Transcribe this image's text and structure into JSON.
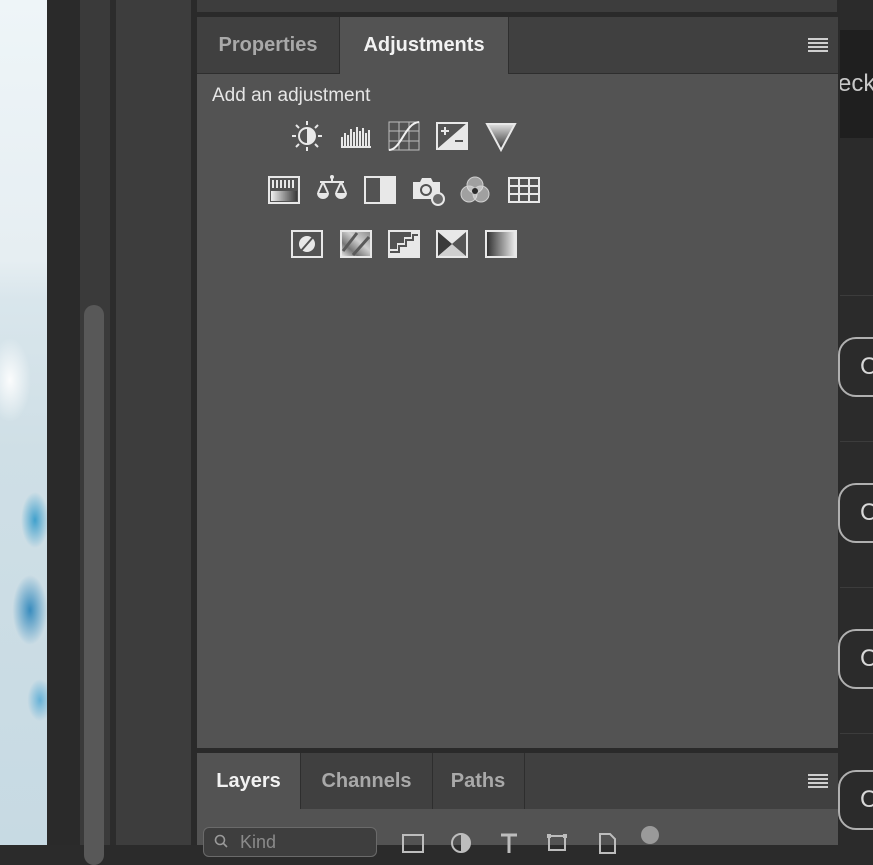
{
  "properties_panel": {
    "tabs": [
      {
        "label": "Properties",
        "active": false
      },
      {
        "label": "Adjustments",
        "active": true
      }
    ],
    "menu_icon": "panel-menu-icon",
    "heading": "Add an adjustment",
    "adjustment_icons": [
      [
        "brightness-contrast-icon",
        "levels-icon",
        "curves-icon",
        "exposure-icon",
        "vibrance-icon"
      ],
      [
        "hue-saturation-icon",
        "color-balance-icon",
        "black-white-icon",
        "photo-filter-icon",
        "channel-mixer-icon",
        "color-lookup-icon"
      ],
      [
        "invert-icon",
        "posterize-icon",
        "threshold-icon",
        "selective-color-icon",
        "gradient-map-icon"
      ]
    ]
  },
  "layers_panel": {
    "tabs": [
      {
        "label": "Layers",
        "active": true
      },
      {
        "label": "Channels",
        "active": false
      },
      {
        "label": "Paths",
        "active": false
      }
    ],
    "menu_icon": "panel-menu-icon",
    "filter_placeholder": "Kind",
    "filter_icons": [
      "pixel-layer-filter-icon",
      "adjustment-layer-filter-icon",
      "type-layer-filter-icon",
      "shape-layer-filter-icon",
      "smart-object-filter-icon",
      "filter-toggle-icon"
    ]
  },
  "right_panel": {
    "header_fragment": "eck",
    "pill_fragment": "C"
  },
  "colors": {
    "panel_bg": "#535353",
    "tabbar_bg": "#404040",
    "active_tab_text": "#f2f2f2",
    "inactive_tab_text": "#a9a9a9"
  }
}
